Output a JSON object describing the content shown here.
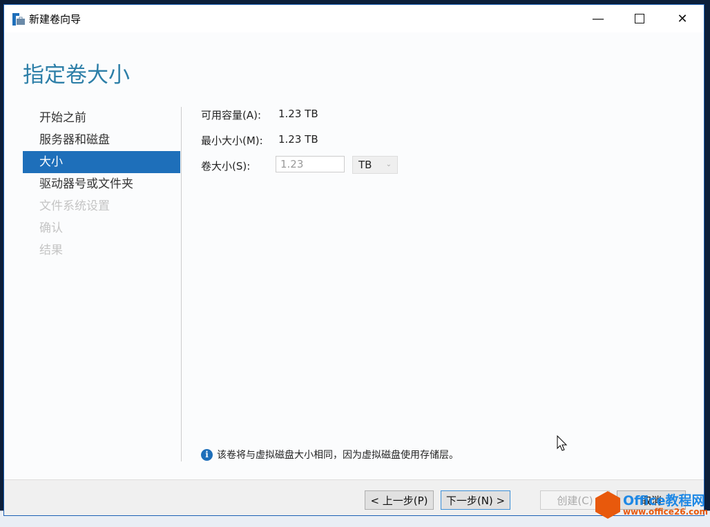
{
  "window": {
    "title": "新建卷向导",
    "minimize_icon": "minimize-icon",
    "maximize_icon": "maximize-icon",
    "close_icon": "close-icon"
  },
  "page": {
    "heading": "指定卷大小"
  },
  "nav": {
    "items": [
      {
        "label": "开始之前",
        "state": "normal"
      },
      {
        "label": "服务器和磁盘",
        "state": "normal"
      },
      {
        "label": "大小",
        "state": "active"
      },
      {
        "label": "驱动器号或文件夹",
        "state": "normal"
      },
      {
        "label": "文件系统设置",
        "state": "disabled"
      },
      {
        "label": "确认",
        "state": "disabled"
      },
      {
        "label": "结果",
        "state": "disabled"
      }
    ]
  },
  "form": {
    "available_label": "可用容量(A):",
    "available_value": "1.23 TB",
    "min_label": "最小大小(M):",
    "min_value": "1.23 TB",
    "size_label": "卷大小(S):",
    "size_value": "1.23",
    "unit_value": "TB"
  },
  "info": {
    "text": "该卷将与虚拟磁盘大小相同，因为虚拟磁盘使用存储层。"
  },
  "buttons": {
    "prev": "< 上一步(P)",
    "next": "下一步(N) >",
    "create": "创建(C)",
    "cancel": "取消"
  },
  "watermark": {
    "line1": "Office教程网",
    "line2": "www.office26.com"
  },
  "colors": {
    "accent": "#1e6fba",
    "heading": "#2d7fa8"
  }
}
